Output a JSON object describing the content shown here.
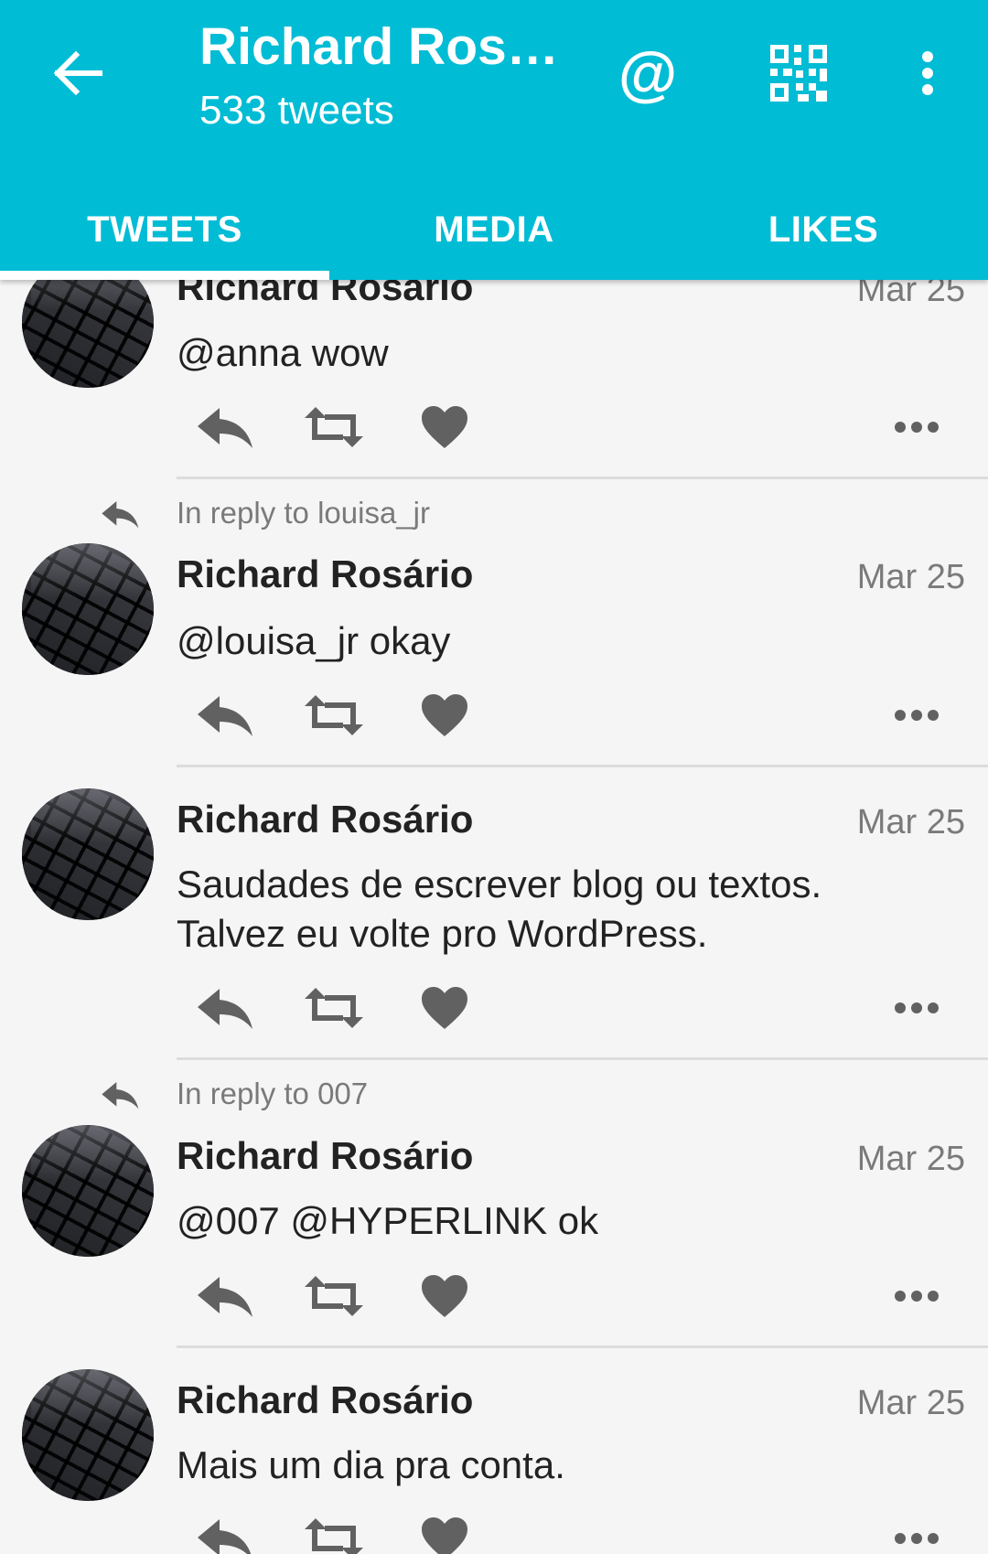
{
  "header": {
    "title": "Richard Ros…",
    "subtitle": "533 tweets"
  },
  "tabs": [
    {
      "label": "TWEETS",
      "active": true
    },
    {
      "label": "MEDIA",
      "active": false
    },
    {
      "label": "LIKES",
      "active": false
    }
  ],
  "colors": {
    "appbar": "#00bcd4",
    "icon": "#616161",
    "secondary_text": "#7a7a7a"
  },
  "tweets": [
    {
      "reply_to": "",
      "name": "Richard Rosário",
      "date": "Mar 25",
      "text": "@anna wow"
    },
    {
      "reply_to": "In reply to louisa_jr",
      "name": "Richard Rosário",
      "date": "Mar 25",
      "text": "@louisa_jr okay"
    },
    {
      "reply_to": "",
      "name": "Richard Rosário",
      "date": "Mar 25",
      "text": "Saudades de escrever blog ou textos. Talvez eu volte pro WordPress."
    },
    {
      "reply_to": "In reply to 007",
      "name": "Richard Rosário",
      "date": "Mar 25",
      "text": "@007 @HYPERLINK ok"
    },
    {
      "reply_to": "",
      "name": "Richard Rosário",
      "date": "Mar 25",
      "text": "Mais um dia pra conta."
    }
  ],
  "icons": {
    "back": "arrow-left-icon",
    "mention": "at-icon",
    "qr": "qr-code-icon",
    "overflow": "more-vert-icon",
    "reply": "reply-icon",
    "retweet": "retweet-icon",
    "like": "heart-icon",
    "tweet_menu": "more-horiz-icon"
  }
}
